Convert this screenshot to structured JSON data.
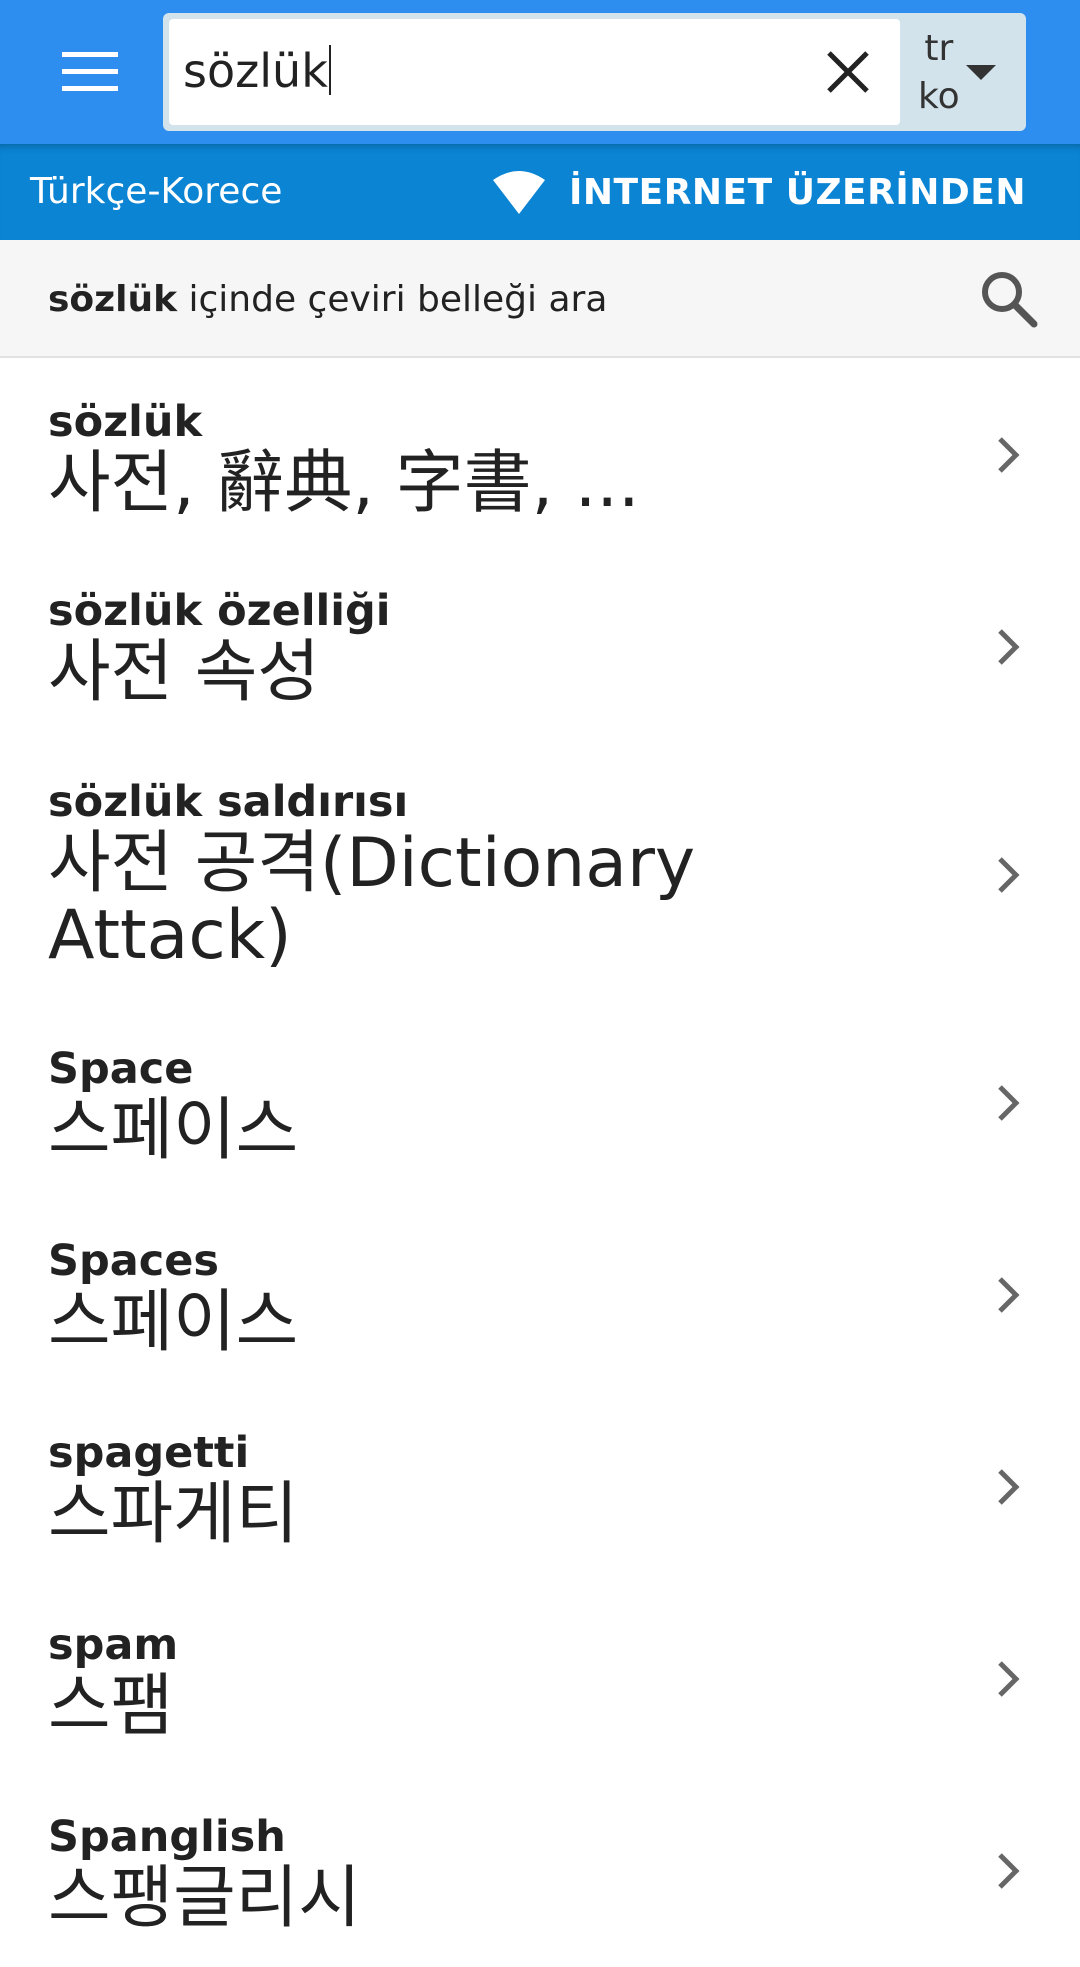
{
  "search": {
    "query": "sözlük",
    "clear_label": "clear-search"
  },
  "language": {
    "from": "tr",
    "to": "ko"
  },
  "subbar": {
    "dictionary_name": "Türkçe-Korece",
    "mode_label": "İNTERNET ÜZERİNDEN"
  },
  "memory_search": {
    "term": "sözlük",
    "suffix": " içinde çeviri belleği ara"
  },
  "results": [
    {
      "term": "sözlük",
      "translation": "사전, 辭典, 字書, ..."
    },
    {
      "term": "sözlük özelliği",
      "translation": "사전 속성"
    },
    {
      "term": "sözlük saldırısı",
      "translation": "사전 공격(Dictionary Attack)"
    },
    {
      "term": "Space",
      "translation": "스페이스"
    },
    {
      "term": "Spaces",
      "translation": "스페이스"
    },
    {
      "term": "spagetti",
      "translation": "스파게티"
    },
    {
      "term": "spam",
      "translation": "스팸"
    },
    {
      "term": "Spanglish",
      "translation": "스팽글리시"
    }
  ],
  "colors": {
    "app_bar": "#2e8ef0",
    "sub_bar": "#0b84d4",
    "memory_row": "#f6f6f6",
    "lang_switch": "#d2e3ec"
  }
}
